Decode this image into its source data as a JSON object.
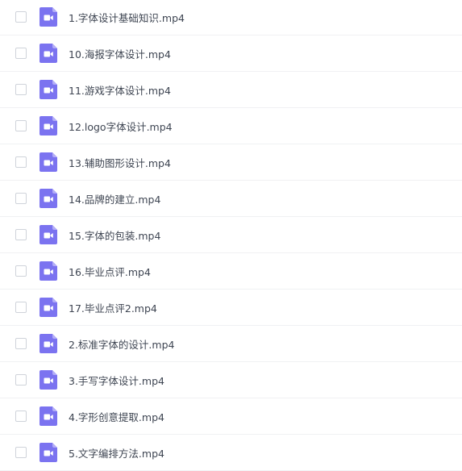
{
  "colors": {
    "icon_bg": "#7b73f0",
    "icon_fold": "#b3adf7",
    "text": "#3e4552",
    "divider": "#f0f1f3",
    "checkbox_border": "#cfd3da"
  },
  "files": [
    {
      "name": "1.字体设计基础知识.mp4",
      "icon": "video-file-icon"
    },
    {
      "name": "10.海报字体设计.mp4",
      "icon": "video-file-icon"
    },
    {
      "name": "11.游戏字体设计.mp4",
      "icon": "video-file-icon"
    },
    {
      "name": "12.logo字体设计.mp4",
      "icon": "video-file-icon"
    },
    {
      "name": "13.辅助图形设计.mp4",
      "icon": "video-file-icon"
    },
    {
      "name": "14.品牌的建立.mp4",
      "icon": "video-file-icon"
    },
    {
      "name": "15.字体的包装.mp4",
      "icon": "video-file-icon"
    },
    {
      "name": "16.毕业点评.mp4",
      "icon": "video-file-icon"
    },
    {
      "name": "17.毕业点评2.mp4",
      "icon": "video-file-icon"
    },
    {
      "name": "2.标准字体的设计.mp4",
      "icon": "video-file-icon"
    },
    {
      "name": "3.手写字体设计.mp4",
      "icon": "video-file-icon"
    },
    {
      "name": "4.字形创意提取.mp4",
      "icon": "video-file-icon"
    },
    {
      "name": "5.文字编排方法.mp4",
      "icon": "video-file-icon"
    }
  ]
}
